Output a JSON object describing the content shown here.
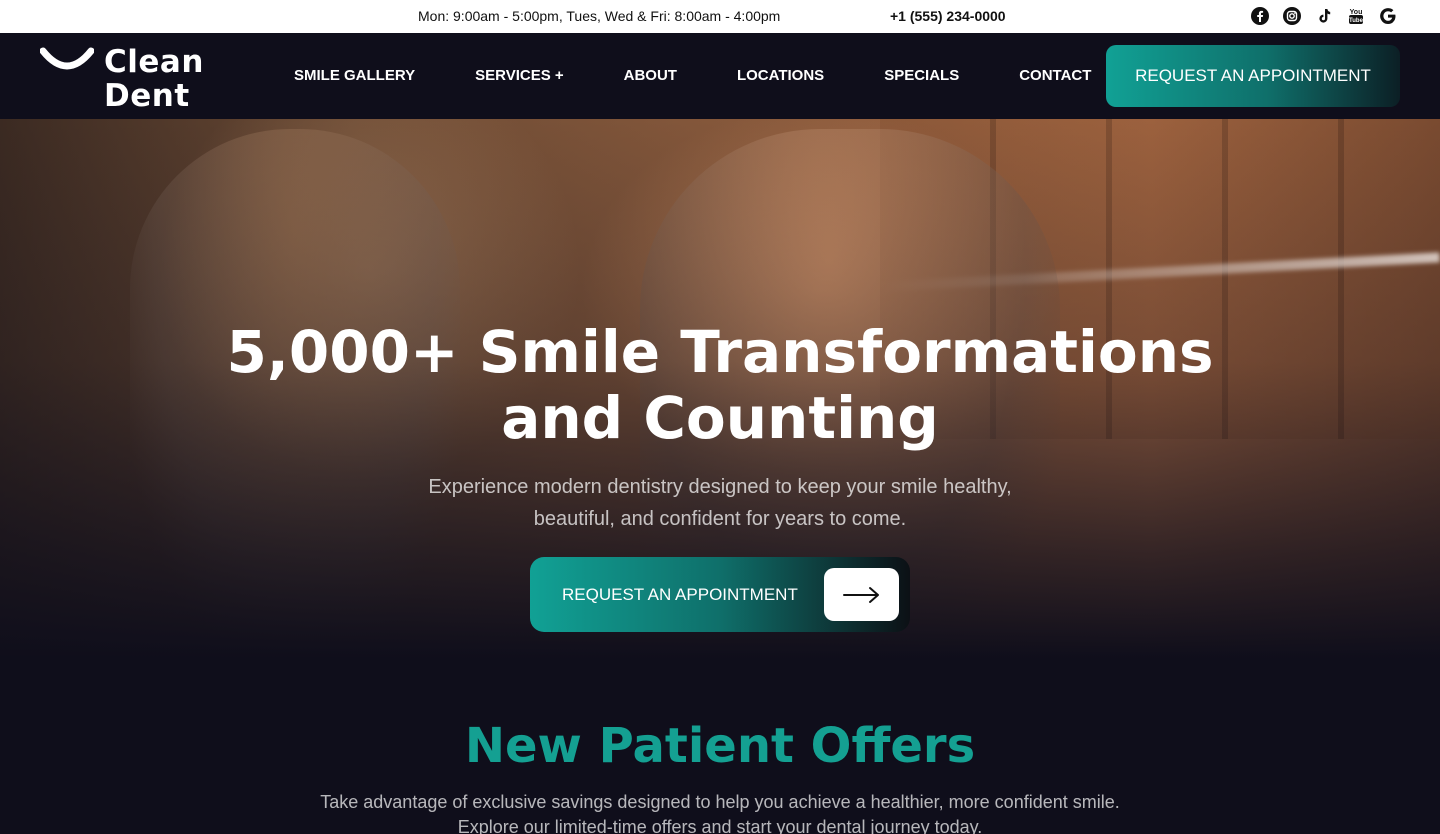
{
  "topbar": {
    "hours": "Mon: 9:00am - 5:00pm, Tues, Wed & Fri: 8:00am - 4:00pm",
    "phone": "+1 (555) 234-0000",
    "socials": [
      "facebook-icon",
      "instagram-icon",
      "tiktok-icon",
      "youtube-icon",
      "google-icon"
    ]
  },
  "nav": {
    "logo_line1": "Clean",
    "logo_line2": "Dent",
    "items": [
      {
        "label": "SMILE GALLERY"
      },
      {
        "label": "SERVICES +"
      },
      {
        "label": "ABOUT"
      },
      {
        "label": "LOCATIONS"
      },
      {
        "label": "SPECIALS"
      },
      {
        "label": "CONTACT"
      }
    ],
    "cta_label": "REQUEST AN APPOINTMENT"
  },
  "hero": {
    "title_line1": "5,000+ Smile Transformations",
    "title_line2": "and Counting",
    "subtitle_line1": "Experience modern dentistry designed to keep your smile healthy,",
    "subtitle_line2": "beautiful, and confident for years to come.",
    "cta_label": "REQUEST AN APPOINTMENT"
  },
  "offers": {
    "title": "New Patient Offers",
    "text_line1": "Take advantage of exclusive savings designed to help you achieve a healthier, more confident smile.",
    "text_line2": "Explore our limited-time offers and start your dental journey today."
  },
  "colors": {
    "accent": "#14a092",
    "background": "#0f0e1b"
  }
}
